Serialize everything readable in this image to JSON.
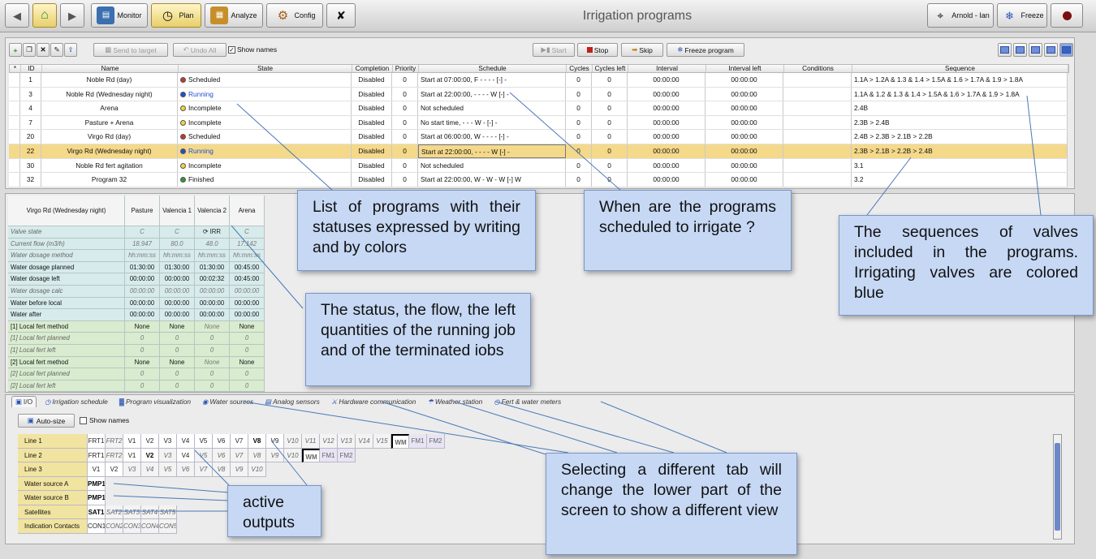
{
  "window": {
    "title": "Irrigation programs"
  },
  "nav": {
    "monitor": "Monitor",
    "plan": "Plan",
    "analyze": "Analyze",
    "config": "Config"
  },
  "user": {
    "name": "Arnold - Ian",
    "freeze": "Freeze"
  },
  "toolbar": {
    "send": "Send to target",
    "undo": "Undo All",
    "show_names": "Show names",
    "start": "Start",
    "stop": "Stop",
    "skip": "Skip",
    "freeze_program": "Freeze program"
  },
  "programs": {
    "headers": [
      "*",
      "ID",
      "Name",
      "State",
      "Completion",
      "Priority",
      "Schedule",
      "Cycles",
      "Cycles left",
      "Interval",
      "Interval left",
      "Conditions",
      "Sequence"
    ],
    "rows": [
      {
        "id": "1",
        "name": "Noble Rd (day)",
        "state": "Scheduled",
        "state_color": "#c0392b",
        "completion": "Disabled",
        "priority": "0",
        "schedule": "Start at 07:00:00, F - - - - [-] -",
        "cycles": "0",
        "cycles_left": "0",
        "interval": "00:00:00",
        "interval_left": "00:00:00",
        "conditions": "",
        "sequence": "1.1A > 1.2A & 1.3 & 1.4 > 1.5A & 1.6 > 1.7A & 1.9 > 1.8A"
      },
      {
        "id": "3",
        "name": "Noble Rd (Wednesday night)",
        "state": "Running",
        "state_color": "#1f4fd1",
        "completion": "Disabled",
        "priority": "0",
        "schedule": "Start at 22:00:00, - - - - W [-] -",
        "cycles": "0",
        "cycles_left": "0",
        "interval": "00:00:00",
        "interval_left": "00:00:00",
        "conditions": "",
        "sequence": "1.1A & 1.2 & 1.3 & 1.4 > 1.5A & 1.6 > 1.7A & 1.9 > 1.8A"
      },
      {
        "id": "4",
        "name": "Arena",
        "state": "Incomplete",
        "state_color": "#f2d43a",
        "completion": "Disabled",
        "priority": "0",
        "schedule": "Not scheduled",
        "cycles": "0",
        "cycles_left": "0",
        "interval": "00:00:00",
        "interval_left": "00:00:00",
        "conditions": "",
        "sequence": "2.4B"
      },
      {
        "id": "7",
        "name": "Pasture + Arena",
        "state": "Incomplete",
        "state_color": "#f2d43a",
        "completion": "Disabled",
        "priority": "0",
        "schedule": "No start time, - - - W - [-] -",
        "cycles": "0",
        "cycles_left": "0",
        "interval": "00:00:00",
        "interval_left": "00:00:00",
        "conditions": "",
        "sequence": "2.3B > 2.4B"
      },
      {
        "id": "20",
        "name": "Virgo Rd (day)",
        "state": "Scheduled",
        "state_color": "#c0392b",
        "completion": "Disabled",
        "priority": "0",
        "schedule": "Start at 06:00:00, W - - - - [-] -",
        "cycles": "0",
        "cycles_left": "0",
        "interval": "00:00:00",
        "interval_left": "00:00:00",
        "conditions": "",
        "sequence": "2.4B > 2.3B > 2.1B > 2.2B"
      },
      {
        "id": "22",
        "name": "Virgo Rd (Wednesday night)",
        "state": "Running",
        "state_color": "#1f4fd1",
        "completion": "Disabled",
        "priority": "0",
        "schedule": "Start at 22:00:00, - - - - W [-] -",
        "cycles": "0",
        "cycles_left": "0",
        "interval": "00:00:00",
        "interval_left": "00:00:00",
        "conditions": "",
        "sequence": "2.3B > 2.1B > 2.2B > 2.4B"
      },
      {
        "id": "30",
        "name": "Noble Rd fert agitation",
        "state": "Incomplete",
        "state_color": "#f2d43a",
        "completion": "Disabled",
        "priority": "0",
        "schedule": "Not scheduled",
        "cycles": "0",
        "cycles_left": "0",
        "interval": "00:00:00",
        "interval_left": "00:00:00",
        "conditions": "",
        "sequence": "3.1"
      },
      {
        "id": "32",
        "name": "Program 32",
        "state": "Finished",
        "state_color": "#2e9b2e",
        "completion": "Disabled",
        "priority": "0",
        "schedule": "Start at 22:00:00, W - W - W [-] W",
        "cycles": "0",
        "cycles_left": "0",
        "interval": "00:00:00",
        "interval_left": "00:00:00",
        "conditions": "",
        "sequence": "3.2"
      }
    ]
  },
  "detail": {
    "title": "Virgo Rd (Wednesday night)",
    "cols": [
      "Pasture",
      "Valencia 1",
      "Valencia 2",
      "Arena"
    ],
    "rows": [
      {
        "label": "Valve state",
        "v": [
          "C",
          "C",
          "IRR",
          "C"
        ],
        "style": "cyan"
      },
      {
        "label": "Current flow (m3/h)",
        "v": [
          "18.947",
          "80.0",
          "48.0",
          "17.142"
        ],
        "style": "cyan"
      },
      {
        "label": "Water dosage method",
        "v": [
          "hh:mm:ss",
          "hh:mm:ss",
          "hh:mm:ss",
          "hh:mm:ss"
        ],
        "style": "cyan-mix"
      },
      {
        "label": "Water dosage planned",
        "v": [
          "01:30:00",
          "01:30:00",
          "01:30:00",
          "00:45:00"
        ],
        "style": "cyan-b"
      },
      {
        "label": "Water dosage left",
        "v": [
          "00:00:00",
          "00:00:00",
          "00:02:32",
          "00:45:00"
        ],
        "style": "cyan-b"
      },
      {
        "label": "Water dosage calc",
        "v": [
          "00:00:00",
          "00:00:00",
          "00:00:00",
          "00:00:00"
        ],
        "style": "cyan"
      },
      {
        "label": "Water before local",
        "v": [
          "00:00:00",
          "00:00:00",
          "00:00:00",
          "00:00:00"
        ],
        "style": "cyan-b"
      },
      {
        "label": "Water after",
        "v": [
          "00:00:00",
          "00:00:00",
          "00:00:00",
          "00:00:00"
        ],
        "style": "cyan-b"
      },
      {
        "label": "[1]  Local fert method",
        "v": [
          "None",
          "None",
          "None",
          "None"
        ],
        "style": "green-b"
      },
      {
        "label": "[1]  Local fert planned",
        "v": [
          "0",
          "0",
          "0",
          "0"
        ],
        "style": "green"
      },
      {
        "label": "[1]  Local fert left",
        "v": [
          "0",
          "0",
          "0",
          "0"
        ],
        "style": "green"
      },
      {
        "label": "[2]  Local fert method",
        "v": [
          "None",
          "None",
          "None",
          "None"
        ],
        "style": "green-b"
      },
      {
        "label": "[2]  Local fert planned",
        "v": [
          "0",
          "0",
          "0",
          "0"
        ],
        "style": "green"
      },
      {
        "label": "[2]  Local fert left",
        "v": [
          "0",
          "0",
          "0",
          "0"
        ],
        "style": "green"
      }
    ]
  },
  "tabs": [
    "I/O",
    "Irrigation schedule",
    "Program visualization",
    "Water sources",
    "Analog sensors",
    "Hardware communication",
    "Weather station",
    "Fert & water meters"
  ],
  "io": {
    "autosize": "Auto-size",
    "show_names": "Show names",
    "rows": [
      {
        "label": "Line 1",
        "cells": [
          [
            "FRT1",
            "n"
          ],
          [
            "FRT2",
            "i"
          ],
          [
            "V1",
            "n"
          ],
          [
            "V2",
            "n"
          ],
          [
            "V3",
            "n"
          ],
          [
            "V4",
            "n"
          ],
          [
            "V5",
            "n"
          ],
          [
            "V6",
            "n"
          ],
          [
            "V7",
            "n"
          ],
          [
            "V8",
            "a"
          ],
          [
            "V9",
            "n"
          ],
          [
            "V10",
            "i"
          ],
          [
            "V11",
            "i"
          ],
          [
            "V12",
            "i"
          ],
          [
            "V13",
            "i"
          ],
          [
            "V14",
            "i"
          ],
          [
            "V15",
            "i"
          ],
          [
            "WM",
            "w"
          ],
          [
            "FM1",
            "f"
          ],
          [
            "FM2",
            "f"
          ]
        ]
      },
      {
        "label": "Line 2",
        "cells": [
          [
            "FRT1",
            "n"
          ],
          [
            "FRT2",
            "i"
          ],
          [
            "V1",
            "n"
          ],
          [
            "V2",
            "a"
          ],
          [
            "V3",
            "i"
          ],
          [
            "V4",
            "n"
          ],
          [
            "V5",
            "i"
          ],
          [
            "V6",
            "i"
          ],
          [
            "V7",
            "i"
          ],
          [
            "V8",
            "i"
          ],
          [
            "V9",
            "i"
          ],
          [
            "V10",
            "i"
          ],
          [
            "WM",
            "w"
          ],
          [
            "FM1",
            "f"
          ],
          [
            "FM2",
            "f"
          ]
        ]
      },
      {
        "label": "Line 3",
        "cells": [
          [
            "V1",
            "n"
          ],
          [
            "V2",
            "n"
          ],
          [
            "V3",
            "i"
          ],
          [
            "V4",
            "i"
          ],
          [
            "V5",
            "i"
          ],
          [
            "V6",
            "i"
          ],
          [
            "V7",
            "i"
          ],
          [
            "V8",
            "i"
          ],
          [
            "V9",
            "i"
          ],
          [
            "V10",
            "i"
          ]
        ]
      },
      {
        "label": "Water source A",
        "cells": [
          [
            "PMP1",
            "a"
          ]
        ]
      },
      {
        "label": "Water source B",
        "cells": [
          [
            "PMP1",
            "a"
          ]
        ]
      },
      {
        "label": "Satellites",
        "cells": [
          [
            "SAT1",
            "a"
          ],
          [
            "SAT2",
            "i"
          ],
          [
            "SAT3",
            "i"
          ],
          [
            "SAT4",
            "i"
          ],
          [
            "SAT5",
            "i"
          ]
        ]
      },
      {
        "label": "Indication Contacts",
        "cells": [
          [
            "CON1",
            "n"
          ],
          [
            "CON2",
            "i"
          ],
          [
            "CON3",
            "i"
          ],
          [
            "CON4",
            "i"
          ],
          [
            "CON5",
            "i"
          ]
        ]
      }
    ]
  },
  "callouts": {
    "programs": "List of programs with their statuses expressed by writing and by colors",
    "schedule": "When are the programs scheduled to irrigate ?",
    "sequence": "The sequences of valves included in the programs. Irrigating valves are colored blue",
    "status": "The status, the flow, the left quantities of the running job and of the terminated iobs",
    "outputs": "active outputs",
    "tabs": "Selecting a different tab will change the lower part of the screen to show a different view"
  }
}
